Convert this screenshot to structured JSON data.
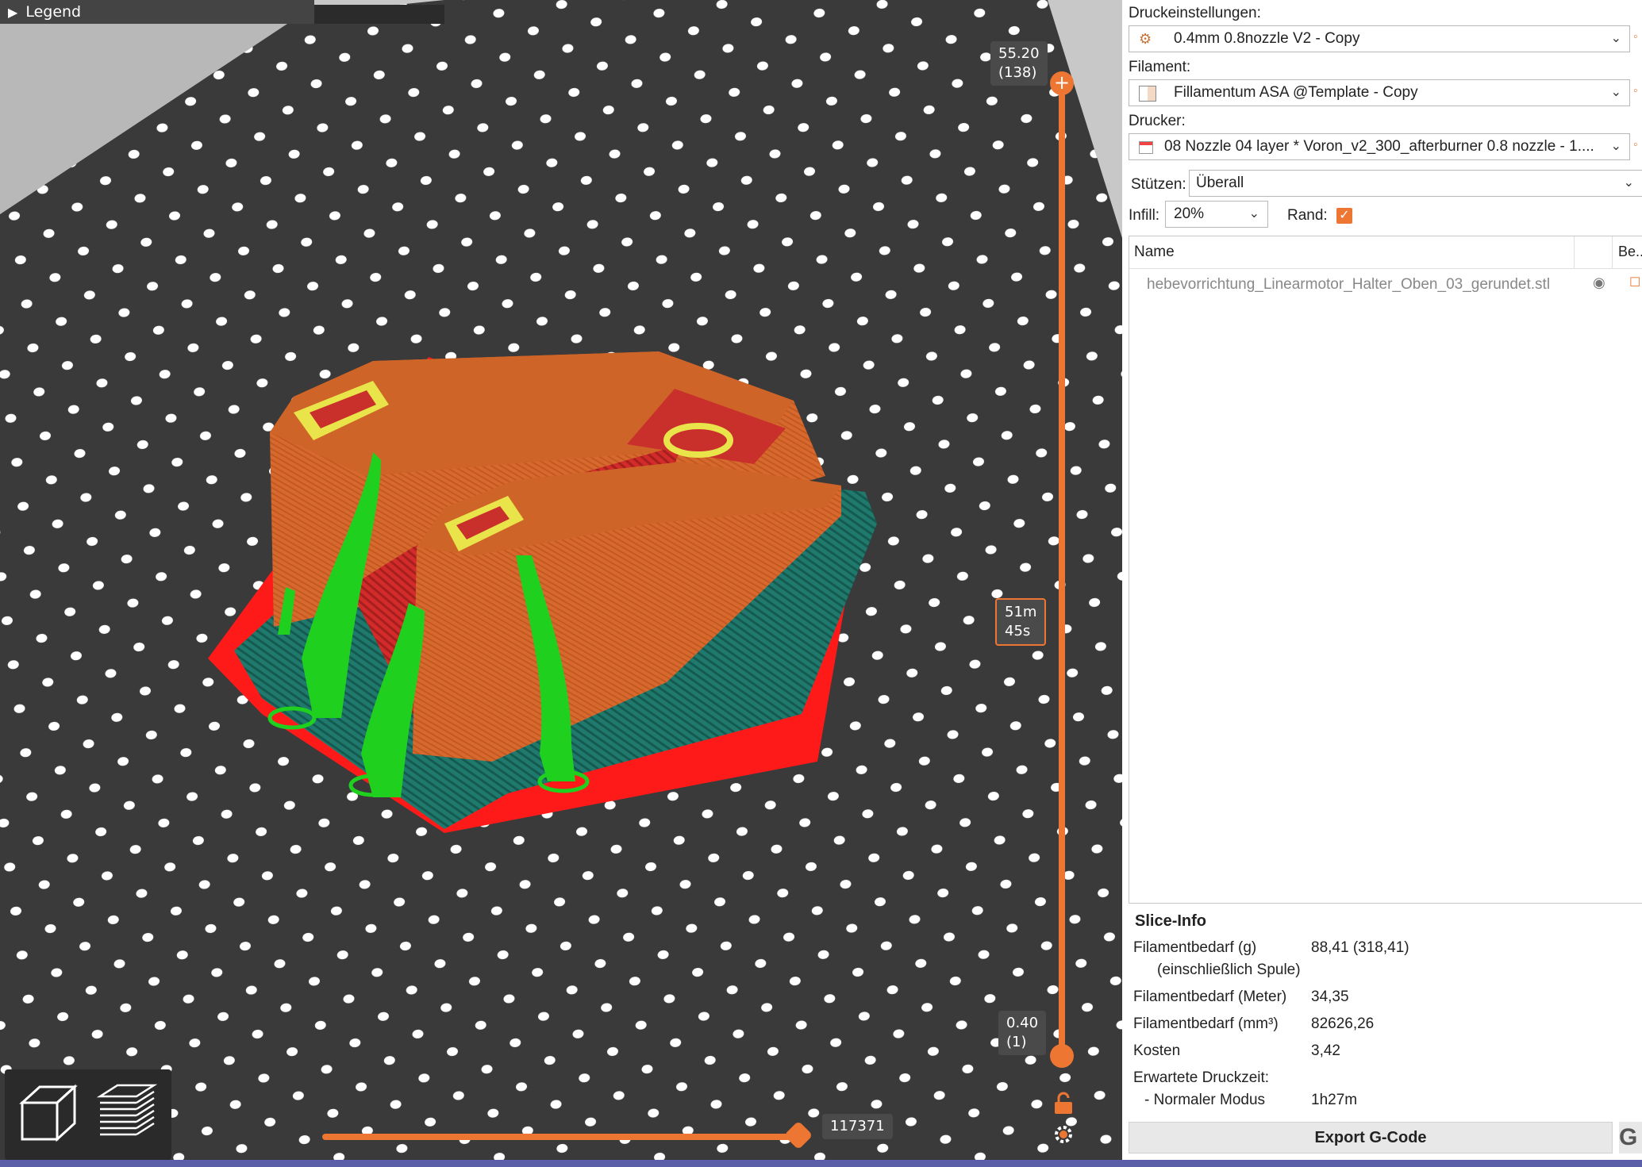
{
  "viewport": {
    "legend_label": "Legend",
    "top_layer": {
      "height": "55.20",
      "layer": "(138)"
    },
    "bottom_layer": {
      "height": "0.40",
      "layer": "(1)"
    },
    "time_estimate": {
      "min": "51m",
      "sec": "45s"
    },
    "move_value": "117371",
    "colors": {
      "bed": "#3a3a3a",
      "part": "#d8692e",
      "support": "#1fd01f",
      "skirt": "#1f6f66",
      "raft": "#ff1a1a",
      "top_infill": "#e8e44a",
      "accent": "#ee7633"
    }
  },
  "panel": {
    "print_settings_label": "Druckeinstellungen:",
    "print_settings_value": "0.4mm 0.8nozzle V2 - Copy",
    "filament_label": "Filament:",
    "filament_value": "Fillamentum ASA @Template - Copy",
    "printer_label": "Drucker:",
    "printer_value": "08 Nozzle 04 layer * Voron_v2_300_afterburner 0.8 nozzle - 1....",
    "supports_label": "Stützen:",
    "supports_value": "Überall",
    "infill_label": "Infill:",
    "infill_value": "20%",
    "brim_label": "Rand:",
    "object_list": {
      "col_name": "Name",
      "col_be": "Be..",
      "object": "hebevorrichtung_Linearmotor_Halter_Oben_03_gerundet.stl"
    },
    "slice_info": {
      "title": "Slice-Info",
      "rows": [
        {
          "label": "Filamentbedarf (g)",
          "value": "88,41 (318,41)"
        },
        {
          "label": "(einschließlich Spule)",
          "value": ""
        },
        {
          "label": "Filamentbedarf (Meter)",
          "value": "34,35"
        },
        {
          "label": "Filamentbedarf (mm³)",
          "value": "82626,26"
        },
        {
          "label": "Kosten",
          "value": "3,42"
        },
        {
          "label": "Erwartete Druckzeit:",
          "value": ""
        },
        {
          "label": "- Normaler Modus",
          "value": "1h27m"
        }
      ]
    },
    "export_label": "Export G-Code",
    "g_label": "G"
  }
}
